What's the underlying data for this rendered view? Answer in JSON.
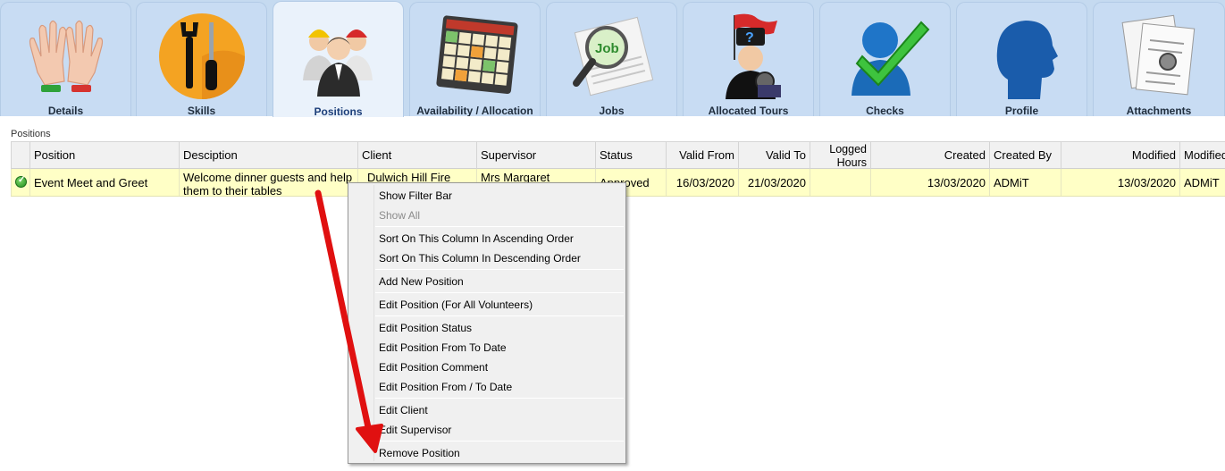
{
  "tabs": [
    {
      "label": "Details",
      "icon": "hands-icon"
    },
    {
      "label": "Skills",
      "icon": "tools-icon"
    },
    {
      "label": "Positions",
      "icon": "people-icon",
      "active": true
    },
    {
      "label": "Availability / Allocation",
      "icon": "calendar-icon"
    },
    {
      "label": "Jobs",
      "icon": "job-search-icon"
    },
    {
      "label": "Allocated Tours",
      "icon": "tour-flag-icon"
    },
    {
      "label": "Checks",
      "icon": "checkmark-person-icon"
    },
    {
      "label": "Profile",
      "icon": "profile-head-icon"
    },
    {
      "label": "Attachments",
      "icon": "documents-icon"
    }
  ],
  "grid": {
    "caption": "Positions",
    "headers": {
      "position": "Position",
      "description": "Desciption",
      "client": "Client",
      "supervisor": "Supervisor",
      "status": "Status",
      "valid_from": "Valid From",
      "valid_to": "Valid To",
      "logged_hours_1": "Logged",
      "logged_hours_2": "Hours",
      "created": "Created",
      "created_by": "Created By",
      "modified": "Modified",
      "modified_by": "Modified"
    },
    "rows": [
      {
        "position": "Event Meet and Greet",
        "description": "Welcome dinner guests and help them to their tables",
        "client": "Dulwich Hill Fire",
        "supervisor": "Mrs Margaret",
        "status": "Approved",
        "valid_from": "16/03/2020",
        "valid_to": "21/03/2020",
        "logged_hours": "",
        "created": "13/03/2020",
        "created_by": "ADMiT",
        "modified": "13/03/2020",
        "modified_by": "ADMiT"
      }
    ]
  },
  "context_menu": {
    "show_filter_bar": "Show Filter Bar",
    "show_all": "Show All",
    "sort_asc": "Sort On This Column In Ascending Order",
    "sort_desc": "Sort On This Column In Descending Order",
    "add_position": "Add New Position",
    "edit_position_all": "Edit Position (For All Volunteers)",
    "edit_status": "Edit Position Status",
    "edit_from_to_date": "Edit Position From To Date",
    "edit_comment": "Edit Position Comment",
    "edit_from_slash_to_date": "Edit Position From / To Date",
    "edit_client": "Edit Client",
    "edit_supervisor": "Edit Supervisor",
    "remove_position": "Remove Position"
  },
  "colors": {
    "tab_bg": "#c8dcf3",
    "tab_active_bg": "#eaf2fb",
    "row_highlight": "#ffffc6",
    "annotation_arrow": "#e01010"
  }
}
